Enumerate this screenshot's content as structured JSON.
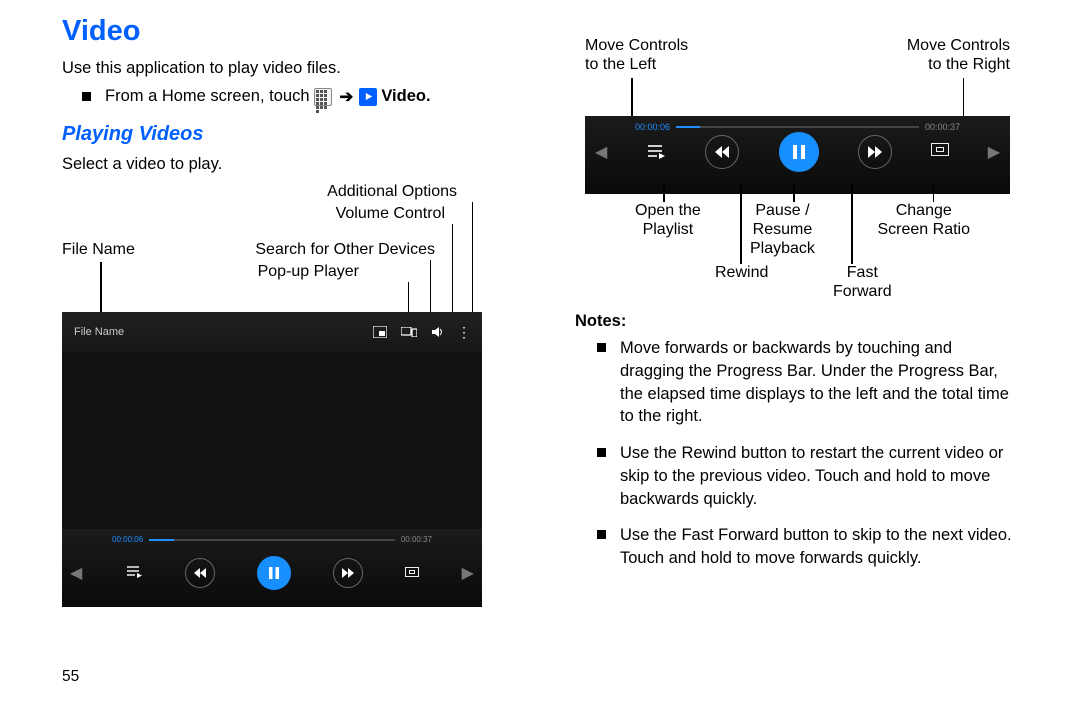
{
  "left": {
    "title": "Video",
    "intro": "Use this application to play video files.",
    "step_prefix": "From a Home screen, touch ",
    "step_video_word": "Video",
    "subtitle": "Playing Videos",
    "select_line": "Select a video to play.",
    "labels": {
      "file_name": "File Name",
      "additional_options": "Additional Options",
      "volume_control": "Volume Control",
      "search_devices": "Search for Other Devices",
      "popup_player": "Pop-up Player"
    }
  },
  "player": {
    "file_name": "File Name",
    "elapsed": "00:00:06",
    "total": "00:00:37"
  },
  "closeup": {
    "elapsed": "00:00:06",
    "total": "00:00:37",
    "labels": {
      "move_left": "Move Controls\nto the Left",
      "move_right": "Move Controls\nto the Right",
      "open_playlist": "Open the\nPlaylist",
      "pause_resume": "Pause /\nResume\nPlayback",
      "screen_ratio": "Change\nScreen Ratio",
      "rewind": "Rewind",
      "fast_forward": "Fast\nForward"
    }
  },
  "notes": {
    "header": "Notes:",
    "items": [
      "Move forwards or backwards by touching and dragging the Progress Bar. Under the Progress Bar, the elapsed time displays to the left and the total time to the right.",
      "Use the Rewind button to restart the current video or skip to the previous video. Touch and hold to move backwards quickly.",
      "Use the Fast Forward button to skip to the next video. Touch and hold to move forwards quickly."
    ]
  },
  "page_number": "55"
}
